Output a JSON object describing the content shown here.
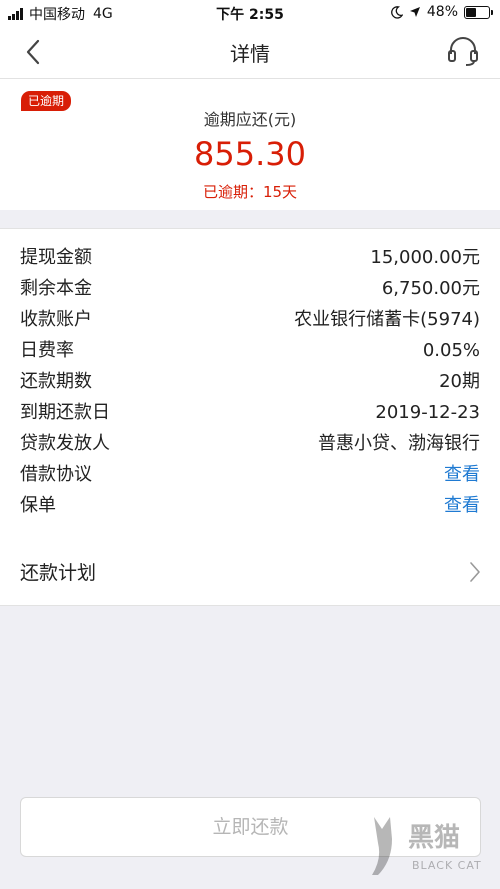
{
  "status_bar": {
    "carrier": "中国移动",
    "network": "4G",
    "time": "下午 2:55",
    "battery_percent": "48%",
    "battery_level": 0.48,
    "signal_bars": 4
  },
  "nav": {
    "title": "详情",
    "back_icon": "chevron-left-icon",
    "service_icon": "headset-icon"
  },
  "summary": {
    "badge": "已逾期",
    "label": "逾期应还(元)",
    "amount": "855.30",
    "overdue_days": "已逾期：15天"
  },
  "details": {
    "rows": [
      {
        "key": "提现金额",
        "value": "15,000.00元",
        "link": false
      },
      {
        "key": "剩余本金",
        "value": "6,750.00元",
        "link": false
      },
      {
        "key": "收款账户",
        "value": "农业银行储蓄卡(5974)",
        "link": false
      },
      {
        "key": "日费率",
        "value": "0.05%",
        "link": false
      },
      {
        "key": "还款期数",
        "value": "20期",
        "link": false
      },
      {
        "key": "到期还款日",
        "value": "2019-12-23",
        "link": false
      },
      {
        "key": "贷款发放人",
        "value": "普惠小贷、渤海银行",
        "link": false
      },
      {
        "key": "借款协议",
        "value": "查看",
        "link": true
      },
      {
        "key": "保单",
        "value": "查看",
        "link": true
      }
    ]
  },
  "plan": {
    "label": "还款计划",
    "icon": "chevron-right-icon"
  },
  "pay_button": {
    "label": "立即还款"
  },
  "watermark": {
    "text": "黑猫",
    "sub": "BLACK CAT"
  },
  "colors": {
    "accent_red": "#d81e06",
    "link_blue": "#1f7ad2",
    "background": "#efeff4",
    "disabled_text": "#b6b6b6"
  }
}
